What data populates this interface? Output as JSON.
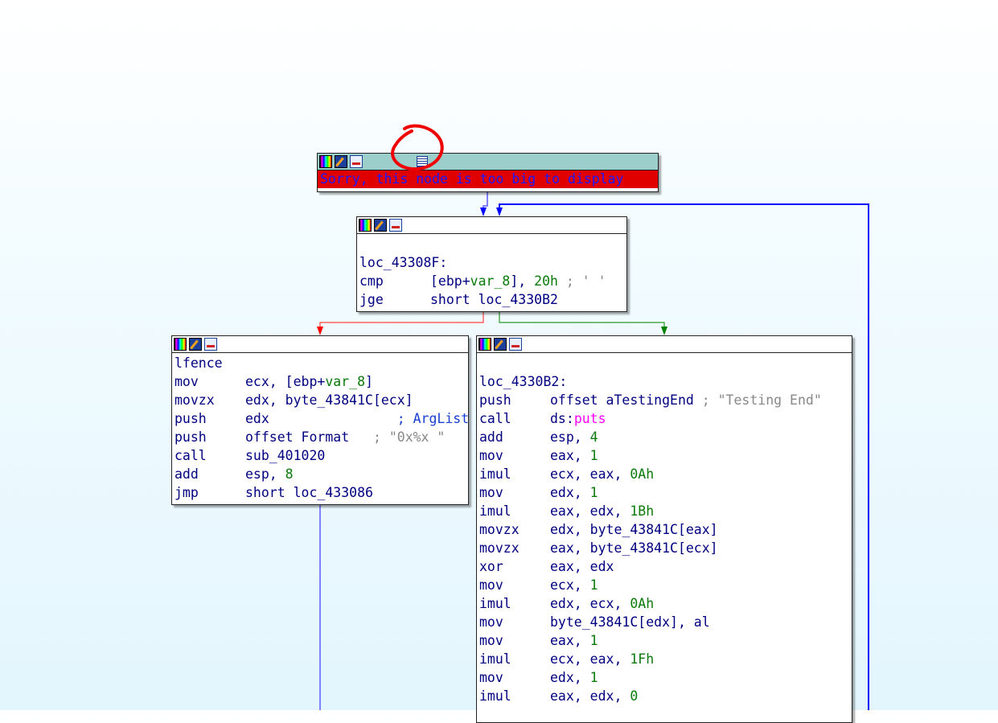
{
  "colors": {
    "text": "#000080",
    "number": "#0a7a0a",
    "import": "#ff00ff",
    "comment": "#888888",
    "edge_true": "#008000",
    "edge_false": "#ff0000",
    "edge_flow": "#0000ff",
    "sorry_bg": "#e00000"
  },
  "sorry_node": {
    "message": "Sorry, this node is too big to display",
    "icons": [
      "color-icon",
      "edit-icon",
      "graph-icon",
      "list-icon"
    ]
  },
  "top_node": {
    "lines": [
      [],
      [
        [
          "loc_43308F:",
          "n"
        ]
      ],
      [
        [
          "cmp",
          "mn"
        ],
        [
          "[ebp+",
          "n"
        ],
        [
          "var_8",
          "g"
        ],
        [
          "], ",
          "n"
        ],
        [
          "20h",
          "g"
        ],
        [
          " ; ' '",
          "c"
        ]
      ],
      [
        [
          "jge",
          "mn"
        ],
        [
          "short loc_4330B2",
          "n"
        ]
      ]
    ]
  },
  "left_node": {
    "lines": [
      [
        [
          "lfence",
          "n"
        ]
      ],
      [
        [
          "mov",
          "mn"
        ],
        [
          "ecx, [ebp+",
          "n"
        ],
        [
          "var_8",
          "g"
        ],
        [
          "]",
          "n"
        ]
      ],
      [
        [
          "movzx",
          "mn"
        ],
        [
          "edx, byte_43841C[ecx]",
          "n"
        ]
      ],
      [
        [
          "push",
          "mn"
        ],
        [
          "edx                ",
          "n"
        ],
        [
          "; ArgList",
          "b"
        ]
      ],
      [
        [
          "push",
          "mn"
        ],
        [
          "offset Format   ",
          "n"
        ],
        [
          "; \"0x%x \"",
          "c"
        ]
      ],
      [
        [
          "call",
          "mn"
        ],
        [
          "sub_401020",
          "n"
        ]
      ],
      [
        [
          "add",
          "mn"
        ],
        [
          "esp, ",
          "n"
        ],
        [
          "8",
          "g"
        ]
      ],
      [
        [
          "jmp",
          "mn"
        ],
        [
          "short loc_433086",
          "n"
        ]
      ]
    ]
  },
  "right_node": {
    "lines": [
      [],
      [
        [
          "loc_4330B2:",
          "n"
        ]
      ],
      [
        [
          "push",
          "mn"
        ],
        [
          "offset aTestingEnd ",
          "n"
        ],
        [
          "; \"Testing End\"",
          "c"
        ]
      ],
      [
        [
          "call",
          "mn"
        ],
        [
          "ds:",
          "n"
        ],
        [
          "puts",
          "m"
        ]
      ],
      [
        [
          "add",
          "mn"
        ],
        [
          "esp, ",
          "n"
        ],
        [
          "4",
          "g"
        ]
      ],
      [
        [
          "mov",
          "mn"
        ],
        [
          "eax, ",
          "n"
        ],
        [
          "1",
          "g"
        ]
      ],
      [
        [
          "imul",
          "mn"
        ],
        [
          "ecx, eax, ",
          "n"
        ],
        [
          "0Ah",
          "g"
        ]
      ],
      [
        [
          "mov",
          "mn"
        ],
        [
          "edx, ",
          "n"
        ],
        [
          "1",
          "g"
        ]
      ],
      [
        [
          "imul",
          "mn"
        ],
        [
          "eax, edx, ",
          "n"
        ],
        [
          "1Bh",
          "g"
        ]
      ],
      [
        [
          "movzx",
          "mn"
        ],
        [
          "edx, byte_43841C[eax]",
          "n"
        ]
      ],
      [
        [
          "movzx",
          "mn"
        ],
        [
          "eax, byte_43841C[ecx]",
          "n"
        ]
      ],
      [
        [
          "xor",
          "mn"
        ],
        [
          "eax, edx",
          "n"
        ]
      ],
      [
        [
          "mov",
          "mn"
        ],
        [
          "ecx, ",
          "n"
        ],
        [
          "1",
          "g"
        ]
      ],
      [
        [
          "imul",
          "mn"
        ],
        [
          "edx, ecx, ",
          "n"
        ],
        [
          "0Ah",
          "g"
        ]
      ],
      [
        [
          "mov",
          "mn"
        ],
        [
          "byte_43841C[edx], al",
          "n"
        ]
      ],
      [
        [
          "mov",
          "mn"
        ],
        [
          "eax, ",
          "n"
        ],
        [
          "1",
          "g"
        ]
      ],
      [
        [
          "imul",
          "mn"
        ],
        [
          "ecx, eax, ",
          "n"
        ],
        [
          "1Fh",
          "g"
        ]
      ],
      [
        [
          "mov",
          "mn"
        ],
        [
          "edx, ",
          "n"
        ],
        [
          "1",
          "g"
        ]
      ],
      [
        [
          "imul",
          "mn"
        ],
        [
          "eax, edx, ",
          "n"
        ],
        [
          "0",
          "g"
        ]
      ]
    ]
  }
}
